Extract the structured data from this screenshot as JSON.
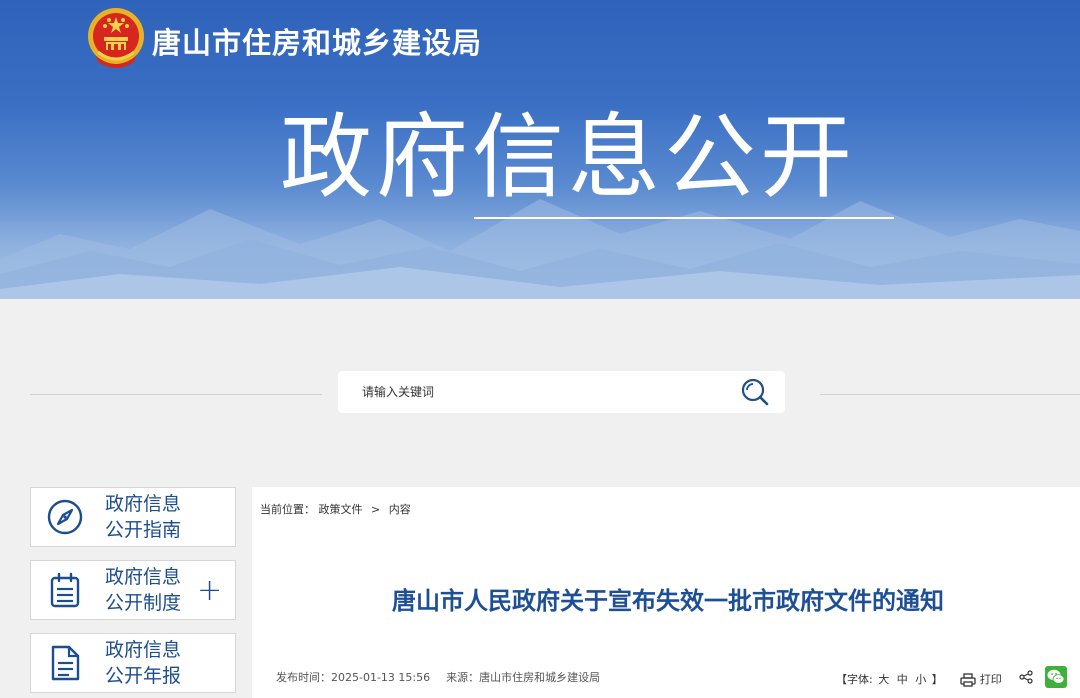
{
  "header": {
    "site_name": "唐山市住房和城乡建设局",
    "banner_title": "政府信息公开",
    "emblem": "national-emblem"
  },
  "search": {
    "placeholder": "请输入关键词",
    "icon": "search-icon"
  },
  "sidebar": {
    "items": [
      {
        "line1": "政府信息",
        "line2": "公开指南",
        "icon": "compass-icon",
        "expandable": false
      },
      {
        "line1": "政府信息",
        "line2": "公开制度",
        "icon": "calendar-icon",
        "expandable": true,
        "expand_symbol": "+"
      },
      {
        "line1": "政府信息",
        "line2": "公开年报",
        "icon": "document-icon",
        "expandable": false
      }
    ]
  },
  "breadcrumb": {
    "label": "当前位置：",
    "items": [
      "政策文件",
      "内容"
    ],
    "separator": ">"
  },
  "article": {
    "title": "唐山市人民政府关于宣布失效一批市政府文件的通知",
    "publish_label": "发布时间：",
    "publish_time": "2025-01-13 15:56",
    "source_label": "来源：",
    "source": "唐山市住房和城乡建设局"
  },
  "toolbar": {
    "font_open": "【字体:",
    "font_large": "大",
    "font_medium": "中",
    "font_small": "小",
    "font_close": "】",
    "print_label": "打印",
    "share_icon": "share-icon",
    "wechat_icon": "wechat-icon"
  },
  "colors": {
    "banner_blue": "#3a6fc4",
    "title_blue": "#1d4f95",
    "menu_blue": "#1c4d8f",
    "wechat_green": "#3fb13a",
    "page_bg": "#f0f0f0"
  }
}
